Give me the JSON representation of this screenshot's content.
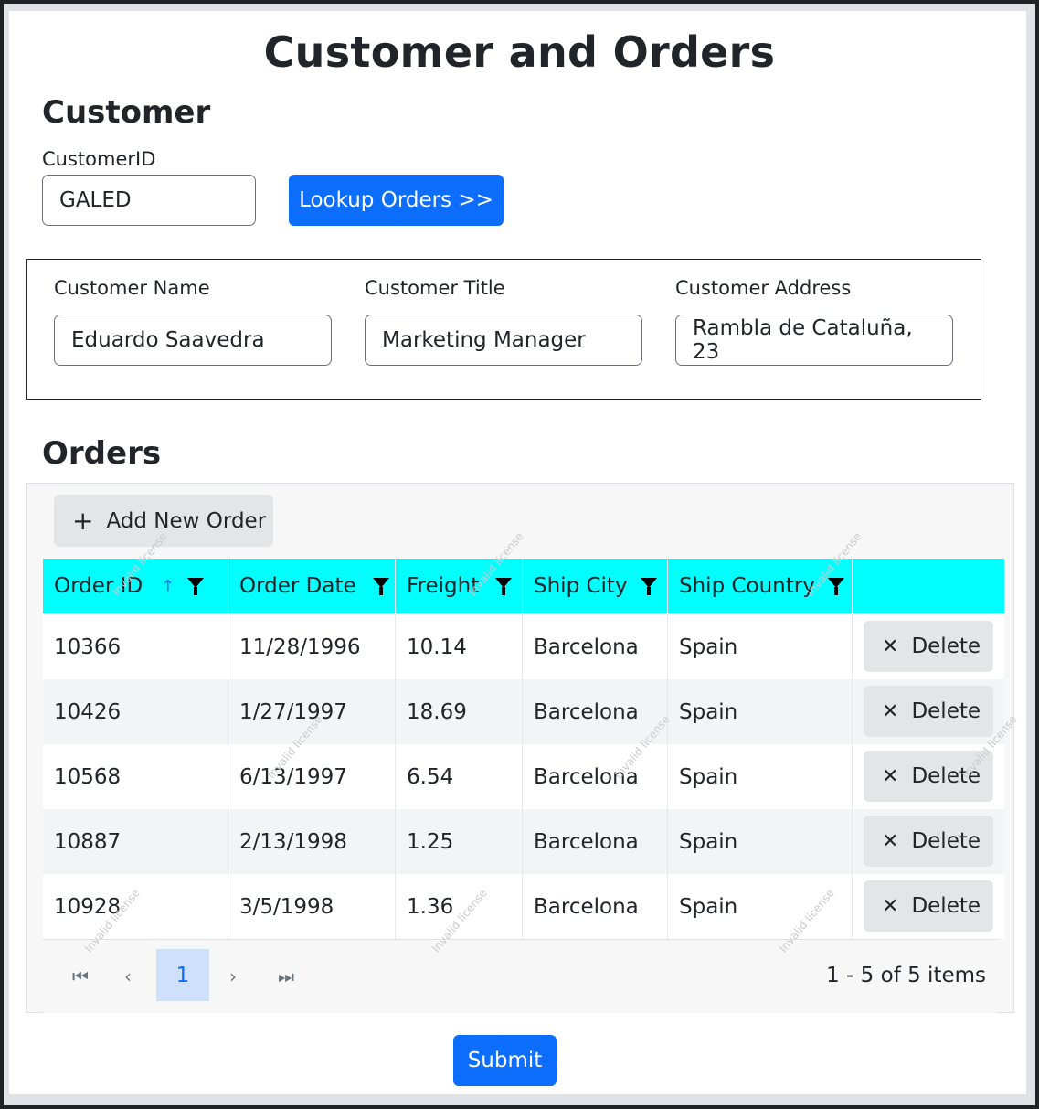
{
  "page": {
    "title": "Customer and Orders"
  },
  "customer": {
    "section_title": "Customer",
    "id_label": "CustomerID",
    "id_value": "GALED",
    "lookup_button": "Lookup Orders >>",
    "name_label": "Customer Name",
    "name_value": "Eduardo Saavedra",
    "title_label": "Customer Title",
    "title_value": "Marketing Manager",
    "address_label": "Customer Address",
    "address_value": "Rambla de Cataluña, 23"
  },
  "orders": {
    "section_title": "Orders",
    "add_button": "Add New Order",
    "columns": [
      "Order ID",
      "Order Date",
      "Freight",
      "Ship City",
      "Ship Country"
    ],
    "sort_column": "Order ID",
    "sort_direction": "ascending",
    "delete_label": "Delete",
    "rows": [
      {
        "order_id": "10366",
        "order_date": "11/28/1996",
        "freight": "10.14",
        "ship_city": "Barcelona",
        "ship_country": "Spain"
      },
      {
        "order_id": "10426",
        "order_date": "1/27/1997",
        "freight": "18.69",
        "ship_city": "Barcelona",
        "ship_country": "Spain"
      },
      {
        "order_id": "10568",
        "order_date": "6/13/1997",
        "freight": "6.54",
        "ship_city": "Barcelona",
        "ship_country": "Spain"
      },
      {
        "order_id": "10887",
        "order_date": "2/13/1998",
        "freight": "1.25",
        "ship_city": "Barcelona",
        "ship_country": "Spain"
      },
      {
        "order_id": "10928",
        "order_date": "3/5/1998",
        "freight": "1.36",
        "ship_city": "Barcelona",
        "ship_country": "Spain"
      }
    ],
    "pager": {
      "current_page": "1",
      "info": "1 - 5 of 5 items"
    },
    "watermark_text": "Invalid license"
  },
  "submit_button": "Submit",
  "colors": {
    "primary": "#0d6efd",
    "header_bg": "#00ffff",
    "page_current_bg": "#cfe0fb"
  },
  "icons": {
    "sort": "arrow-up-icon",
    "filter": "filter-icon",
    "add": "plus-icon",
    "delete": "close-icon",
    "pager": [
      "first-page-icon",
      "previous-page-icon",
      "next-page-icon",
      "last-page-icon"
    ]
  }
}
